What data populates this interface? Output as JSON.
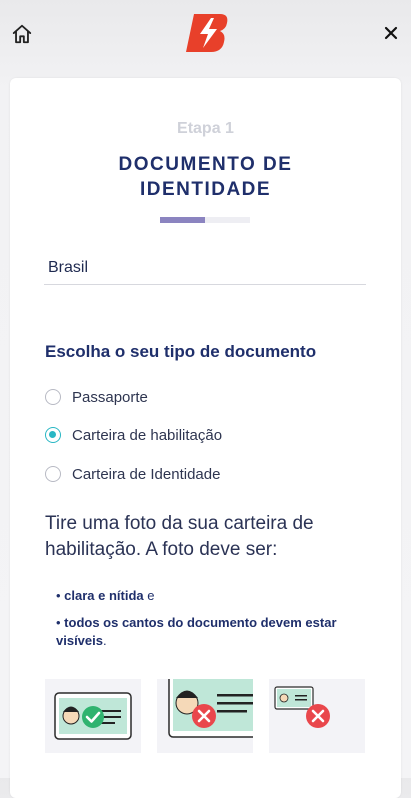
{
  "header": {
    "home_icon": "home-icon",
    "logo_icon": "brand-b-logo",
    "close_icon": "close-icon",
    "brand_color": "#e8402a"
  },
  "step": {
    "label": "Etapa 1",
    "title_line1": "DOCUMENTO DE",
    "title_line2": "IDENTIDADE",
    "progress_fraction": 0.5
  },
  "country": {
    "value": "Brasil"
  },
  "document_type": {
    "heading": "Escolha o seu tipo de documento",
    "options": [
      {
        "label": "Passaporte",
        "selected": false
      },
      {
        "label": "Carteira de habilitação",
        "selected": true
      },
      {
        "label": "Carteira de Identidade",
        "selected": false
      }
    ],
    "accent": "#29b7c4"
  },
  "instructions": {
    "text": "Tire uma foto da sua carteira de habilitação. A foto deve ser:",
    "bullets": [
      {
        "bold": "clara e nítida",
        "rest": " e"
      },
      {
        "bold": "todos os cantos do documento devem estar visíveis",
        "rest": "."
      }
    ]
  },
  "examples": [
    {
      "status": "correct",
      "icon": "check-icon"
    },
    {
      "status": "incorrect",
      "icon": "x-icon"
    },
    {
      "status": "incorrect",
      "icon": "x-icon"
    }
  ]
}
